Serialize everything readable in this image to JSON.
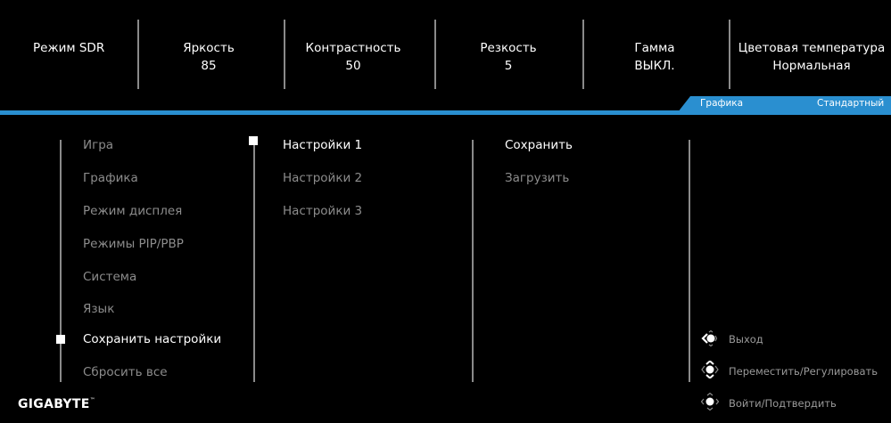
{
  "header": {
    "stats": [
      {
        "label": "Режим SDR",
        "value": ""
      },
      {
        "label": "Яркость",
        "value": "85"
      },
      {
        "label": "Контрастность",
        "value": "50"
      },
      {
        "label": "Резкость",
        "value": "5"
      },
      {
        "label": "Гамма",
        "value": "ВЫКЛ."
      },
      {
        "label": "Цветовая температура",
        "value": "Нормальная"
      }
    ],
    "tab_category": "Графика",
    "tab_mode": "Стандартный"
  },
  "colors": {
    "accent": "#2a8fd0",
    "background": "#000000",
    "inactive_text": "#8c8c8c",
    "active_text": "#ffffff"
  },
  "main_menu": {
    "items": [
      {
        "label": "Игра",
        "active": false
      },
      {
        "label": "Графика",
        "active": false
      },
      {
        "label": "Режим дисплея",
        "active": false
      },
      {
        "label": "Режимы PIP/PBP",
        "active": false
      },
      {
        "label": "Система",
        "active": false
      },
      {
        "label": "Язык",
        "active": false
      },
      {
        "label": "Сохранить настройки",
        "active": true
      },
      {
        "label": "Сбросить все",
        "active": false
      }
    ]
  },
  "sub_menu": {
    "items": [
      {
        "label": "Настройки 1",
        "active": true
      },
      {
        "label": "Настройки 2",
        "active": false
      },
      {
        "label": "Настройки 3",
        "active": false
      }
    ]
  },
  "action_menu": {
    "items": [
      {
        "label": "Сохранить",
        "active": true
      },
      {
        "label": "Загрузить",
        "active": false
      }
    ]
  },
  "hints": [
    {
      "icon": "joystick-left-icon",
      "label": "Выход"
    },
    {
      "icon": "joystick-move-icon",
      "label": "Переместить/Регулировать"
    },
    {
      "icon": "joystick-press-icon",
      "label": "Войти/Подтвердить"
    }
  ],
  "brand": {
    "name": "GIGABYTE",
    "mark": "™"
  }
}
